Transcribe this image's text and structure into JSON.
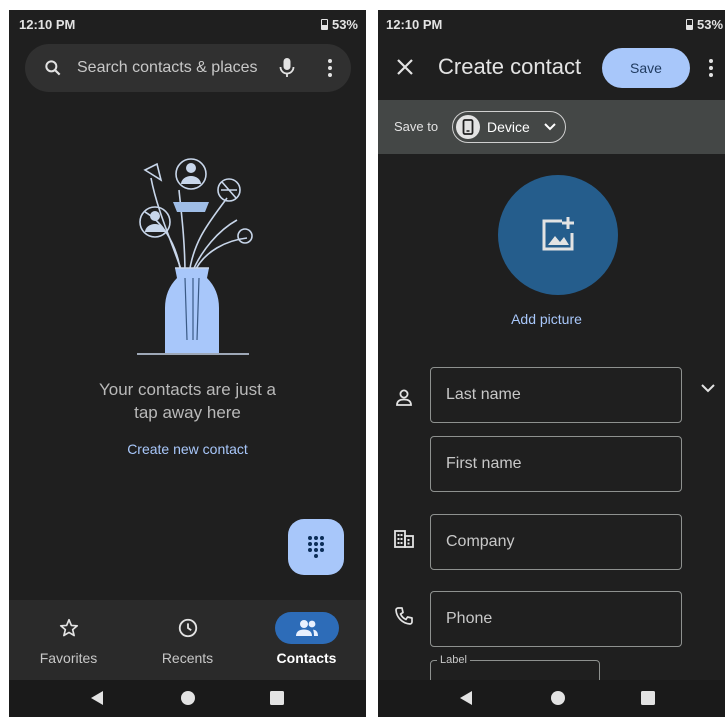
{
  "left": {
    "status": {
      "time": "12:10 PM",
      "battery": "53%"
    },
    "search": {
      "placeholder": "Search contacts & places"
    },
    "empty_state": {
      "line1": "Your contacts are just a",
      "line2": "tap away here",
      "link": "Create new contact"
    },
    "bottom_nav": [
      {
        "label": "Favorites",
        "icon": "star-icon",
        "active": false
      },
      {
        "label": "Recents",
        "icon": "clock-icon",
        "active": false
      },
      {
        "label": "Contacts",
        "icon": "people-icon",
        "active": true
      }
    ],
    "fab": {
      "icon": "dialpad-icon"
    }
  },
  "right": {
    "status": {
      "time": "12:10 PM",
      "battery": "53%"
    },
    "header": {
      "title": "Create contact",
      "save_label": "Save"
    },
    "save_to": {
      "label": "Save to",
      "account": "Device"
    },
    "add_picture": "Add picture",
    "fields": {
      "last_name": "Last name",
      "first_name": "First name",
      "company": "Company",
      "phone": "Phone",
      "label": "Label"
    }
  },
  "colors": {
    "background": "#1f1f1f",
    "accent": "#a8c7fa",
    "avatar": "#255d8c",
    "nav_active": "#2d6cb8"
  }
}
